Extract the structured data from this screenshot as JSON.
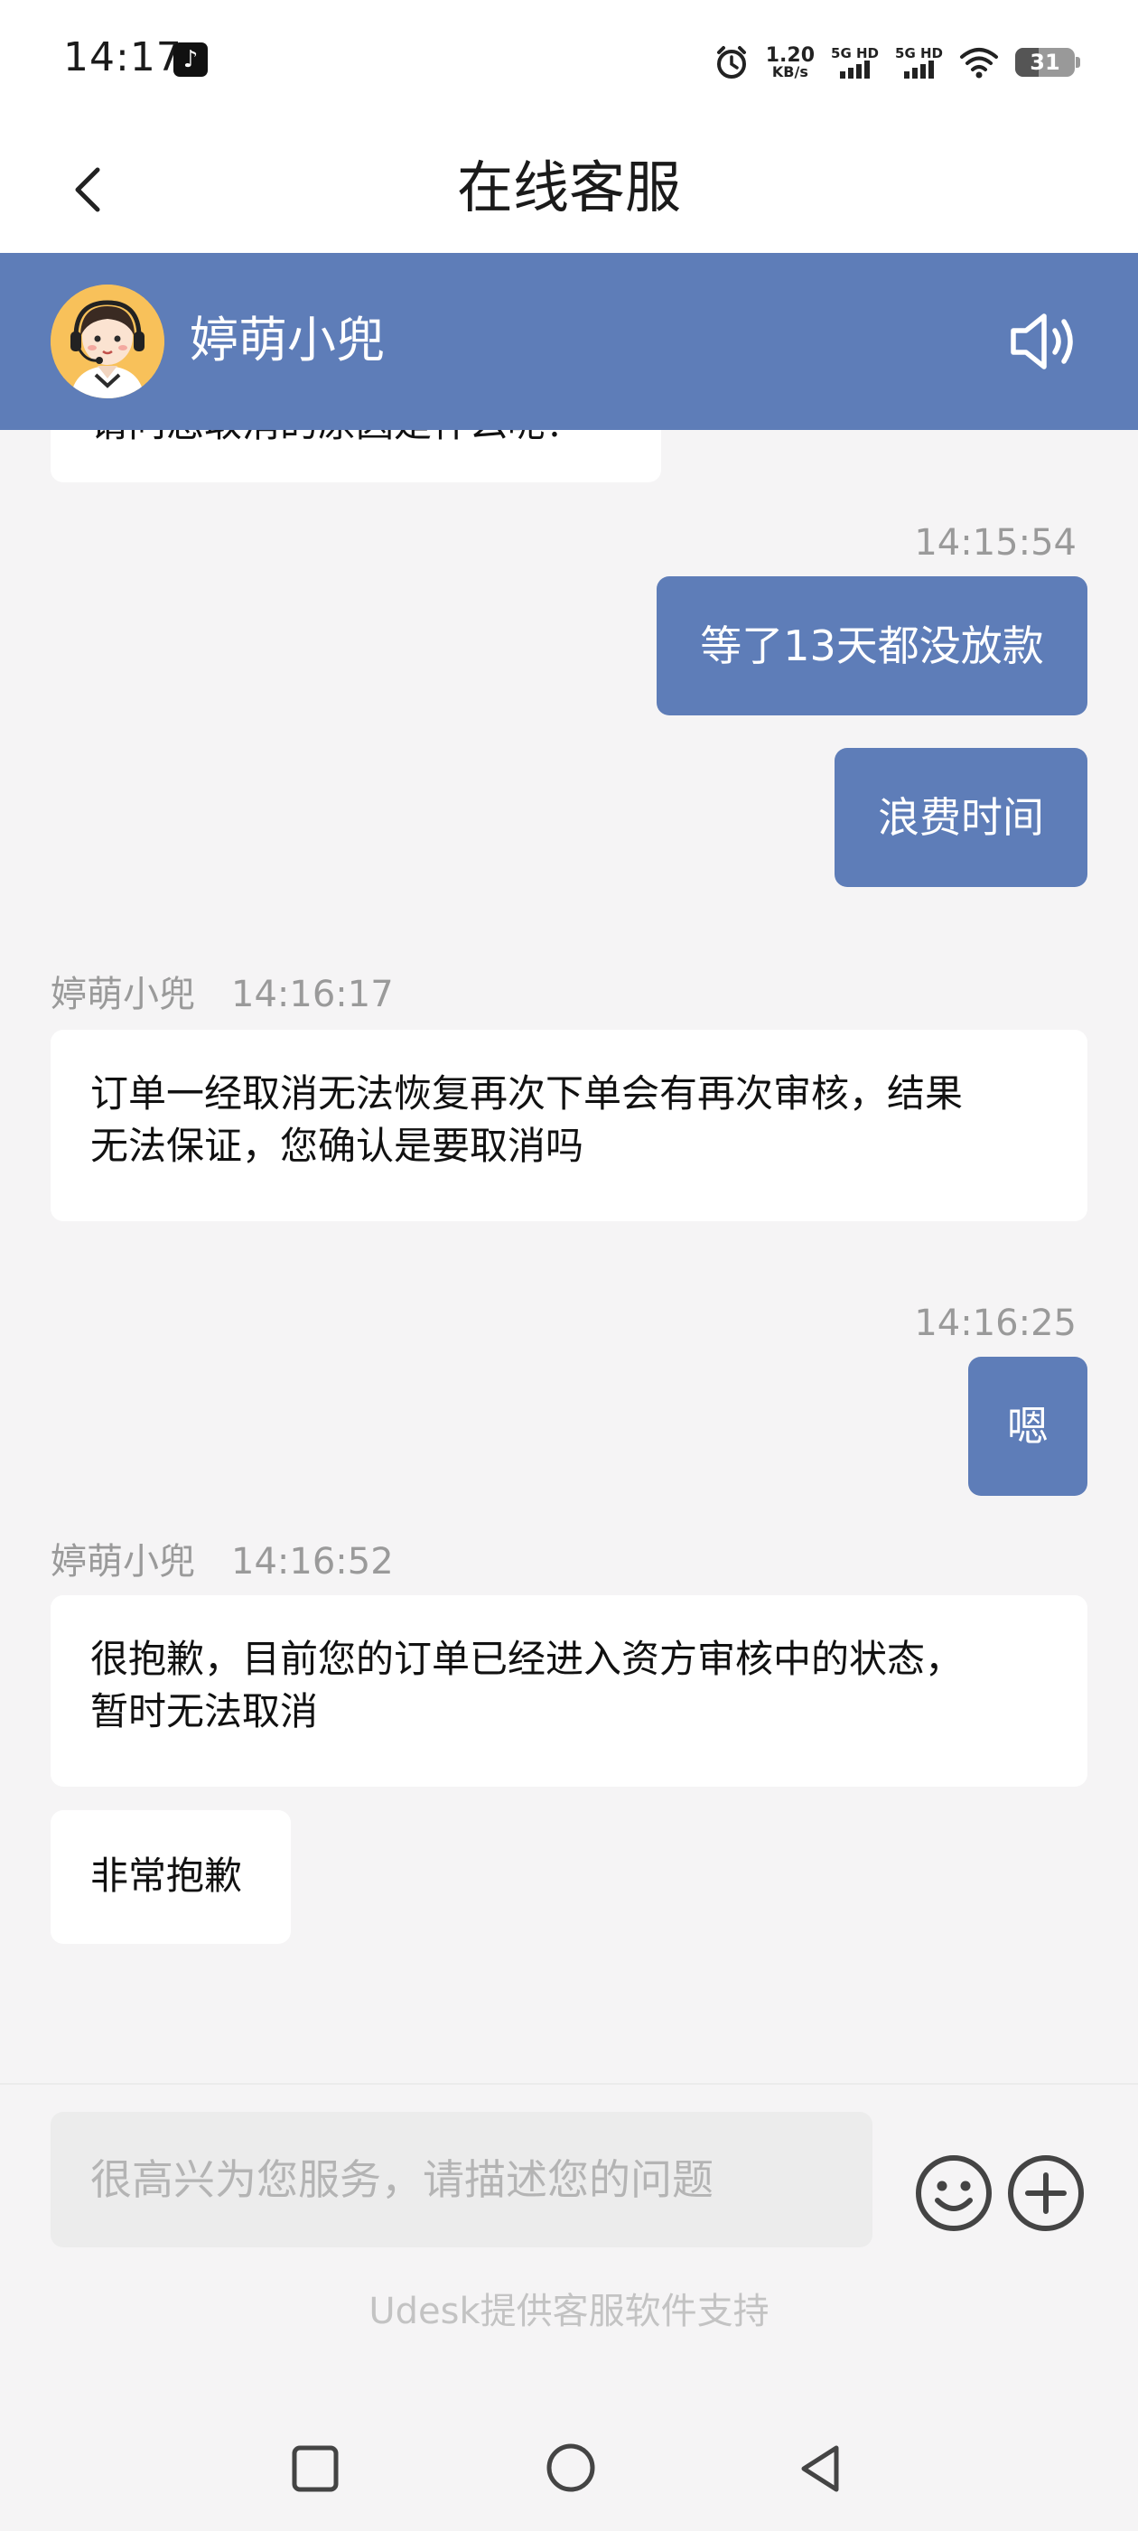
{
  "status_bar": {
    "time": "14:17",
    "app_icon": "tiktok-icon",
    "alarm_icon": "alarm-clock-icon",
    "speed_value": "1.20",
    "speed_unit": "KB/s",
    "network1": "5G HD",
    "network2": "5G HD",
    "wifi_icon": "wifi-icon",
    "battery": "31"
  },
  "nav": {
    "back_icon": "chevron-left-icon",
    "title": "在线客服"
  },
  "agent": {
    "name": "婷萌小兜",
    "avatar_icon": "support-agent-avatar",
    "speaker_icon": "speaker-volume-icon"
  },
  "messages": {
    "partial_text": "请问您取消的原因是什么呢？",
    "m1": {
      "time": "14:15:54",
      "text": "等了13天都没放款"
    },
    "m2": {
      "text": "浪费时间"
    },
    "m3": {
      "sender": "婷萌小兜",
      "time": "14:16:17",
      "line1": "订单一经取消无法恢复再次下单会有再次审核，结果",
      "line2": "无法保证，您确认是要取消吗"
    },
    "m4": {
      "time": "14:16:25",
      "text": "嗯"
    },
    "m5": {
      "sender": "婷萌小兜",
      "time": "14:16:52",
      "line1": "很抱歉，目前您的订单已经进入资方审核中的状态，",
      "line2": "暂时无法取消"
    },
    "m6": {
      "text": "非常抱歉"
    }
  },
  "input": {
    "placeholder": "很高兴为您服务，请描述您的问题",
    "emoji_icon": "emoji-smile-icon",
    "plus_icon": "plus-circle-icon",
    "footer": "Udesk提供客服软件支持"
  },
  "system_nav": {
    "recents_icon": "square-recents-icon",
    "home_icon": "circle-home-icon",
    "back_icon": "triangle-back-icon"
  },
  "colors": {
    "accent": "#5e7db8",
    "background": "#f5f4f5",
    "bubble_left": "#ffffff",
    "timestamp": "#9a9a9a"
  }
}
